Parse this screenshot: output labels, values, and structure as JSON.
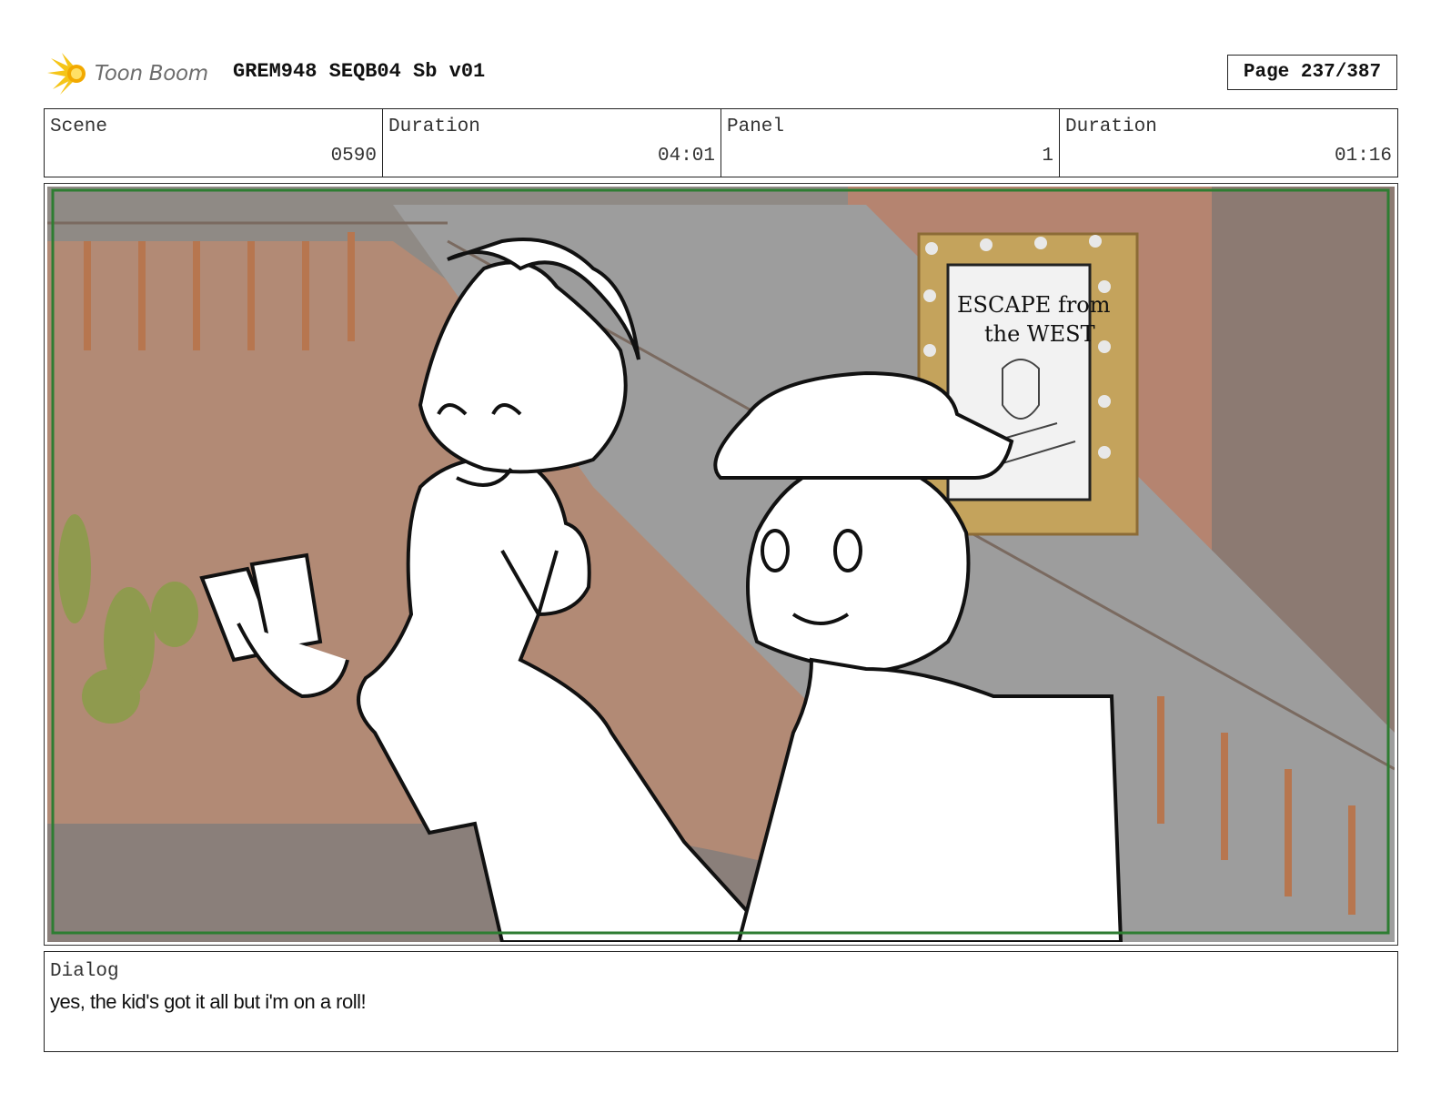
{
  "header": {
    "logo_text": "Toon Boom",
    "title": "GREM948 SEQB04 Sb v01",
    "page": "Page 237/387"
  },
  "info": {
    "scene_label": "Scene",
    "scene_value": "0590",
    "scene_duration_label": "Duration",
    "scene_duration_value": "04:01",
    "panel_label": "Panel",
    "panel_value": "1",
    "panel_duration_label": "Duration",
    "panel_duration_value": "01:16"
  },
  "panel": {
    "poster_line1": "ESCAPE from",
    "poster_line2": "the WEST"
  },
  "dialog": {
    "label": "Dialog",
    "text": "yes, the kid's got it all but i'm on a roll!"
  },
  "colors": {
    "frame_green": "#2e7d32",
    "wall": "#b07f66",
    "logo_yellow": "#f5c518"
  }
}
